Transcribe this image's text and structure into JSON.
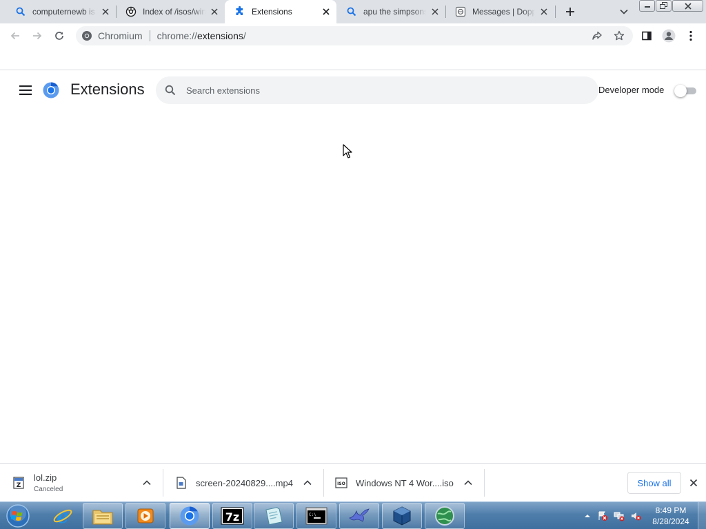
{
  "browser": {
    "tabs": [
      {
        "title": "computernewb is",
        "icon": "search-icon"
      },
      {
        "title": "Index of /isos/win",
        "icon": "site-favicon-icon"
      },
      {
        "title": "Extensions",
        "icon": "puzzle-icon",
        "active": true
      },
      {
        "title": "apu the simpsons",
        "icon": "search-icon"
      },
      {
        "title": "Messages | Doppl",
        "icon": "globe-icon"
      }
    ],
    "omnibox": {
      "site_name": "Chromium",
      "url_scheme": "chrome://",
      "url_host": "extensions",
      "url_path": "/"
    }
  },
  "extensions_page": {
    "title": "Extensions",
    "search_placeholder": "Search extensions",
    "developer_mode_label": "Developer mode",
    "developer_mode_on": false
  },
  "downloads": {
    "items": [
      {
        "name": "lol.zip",
        "status": "Canceled",
        "icon": "zip-file-icon"
      },
      {
        "name": "screen-20240829....mp4",
        "status": "",
        "icon": "video-file-icon"
      },
      {
        "name": "Windows NT 4 Wor....iso",
        "status": "",
        "icon": "disc-image-icon"
      }
    ],
    "show_all_label": "Show all"
  },
  "taskbar": {
    "apps": [
      {
        "name": "internet-explorer",
        "icon": "internet-explorer-icon"
      },
      {
        "name": "file-explorer",
        "icon": "folder-icon"
      },
      {
        "name": "media-player",
        "icon": "media-player-icon"
      },
      {
        "name": "chromium",
        "icon": "chromium-icon",
        "active": true
      },
      {
        "name": "7-zip",
        "icon": "7zip-icon"
      },
      {
        "name": "notepad",
        "icon": "notepad-icon"
      },
      {
        "name": "command-prompt",
        "icon": "terminal-icon"
      },
      {
        "name": "bird-app",
        "icon": "bird-icon"
      },
      {
        "name": "virtualbox",
        "icon": "virtualbox-icon"
      },
      {
        "name": "globe-app",
        "icon": "globe-icon"
      }
    ],
    "clock_time": "8:49 PM",
    "clock_date": "8/28/2024"
  },
  "colors": {
    "tabstrip_bg": "#dee1e6",
    "accent_blue": "#1a73e8",
    "taskbar_blue": "#4f7eab"
  }
}
